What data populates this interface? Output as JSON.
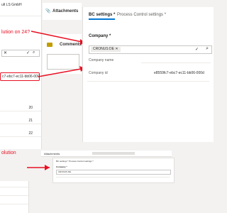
{
  "left_panel": {
    "company_snippet": "ult LS GmbH",
    "annotation_top": "lution on 24?",
    "guid_snippet": "c7-ebc7-ec11-bb06-000",
    "rows": [
      "20",
      "21",
      "22"
    ],
    "annotation_bottom": "olution"
  },
  "attachments": {
    "title": "Attachments"
  },
  "comments": {
    "title": "Comments"
  },
  "settings": {
    "tabs": [
      "BC settings *",
      "Process Control settings *"
    ],
    "company_label": "Company *",
    "company_value": "CRONUS DE",
    "company_name_label": "Company name",
    "company_id_label": "Company id",
    "company_id_value": "e8559fc7-ebc7-ec11-bb06-000d"
  },
  "mini": {
    "attachments_title": "Attachments",
    "header_text": "BC settings *  Process Control settings *",
    "company_label": "Company *",
    "company_value": "CRONUS DE",
    "annotation": "olution"
  },
  "colors": {
    "accent": "#0078d4",
    "annotation": "#e81123"
  },
  "icons": [
    "paperclip-icon",
    "comment-icon",
    "close-icon",
    "checkmark-icon",
    "search-icon",
    "arrow-icon"
  ]
}
